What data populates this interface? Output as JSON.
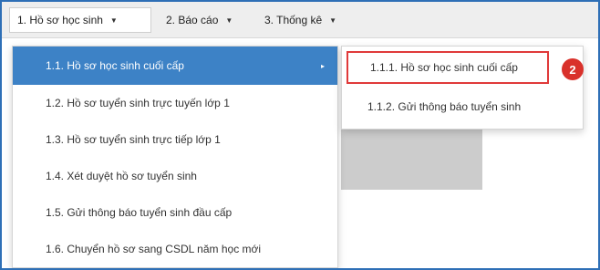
{
  "menubar": {
    "items": [
      {
        "label": "1. Hồ sơ học sinh",
        "caret": "▼"
      },
      {
        "label": "2. Báo cáo",
        "caret": "▼"
      },
      {
        "label": "3. Thống kê",
        "caret": "▼"
      }
    ]
  },
  "dropdown": {
    "items": [
      {
        "label": "1.1. Hồ sơ học sinh cuối cấp",
        "arrow": "▸"
      },
      {
        "label": "1.2. Hồ sơ tuyển sinh trực tuyến lớp 1"
      },
      {
        "label": "1.3. Hồ sơ tuyển sinh trực tiếp lớp 1"
      },
      {
        "label": "1.4. Xét duyệt hồ sơ tuyển sinh"
      },
      {
        "label": "1.5. Gửi thông báo tuyển sinh đầu cấp"
      },
      {
        "label": "1.6. Chuyển hồ sơ sang CSDL năm học mới"
      }
    ]
  },
  "submenu": {
    "items": [
      {
        "label": "1.1.1. Hồ sơ học sinh cuối cấp"
      },
      {
        "label": "1.1.2. Gửi thông báo tuyển sinh"
      }
    ]
  },
  "step_badge": "2",
  "colors": {
    "highlight": "#3d82c6",
    "callout_red": "#e03a3a",
    "badge_red": "#d9312b",
    "frame_blue": "#2e6fb6"
  }
}
